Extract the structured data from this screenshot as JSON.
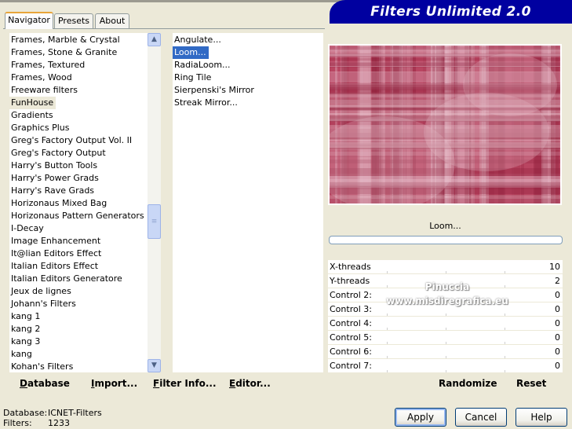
{
  "header": {
    "title": "Filters Unlimited 2.0"
  },
  "tabs": [
    {
      "label": "Navigator",
      "active": true
    },
    {
      "label": "Presets",
      "active": false
    },
    {
      "label": "About",
      "active": false
    }
  ],
  "categories": [
    "Frames, Marble & Crystal",
    "Frames, Stone & Granite",
    "Frames, Textured",
    "Frames, Wood",
    "Freeware filters",
    "FunHouse",
    "Gradients",
    "Graphics Plus",
    "Greg's Factory Output Vol. II",
    "Greg's Factory Output",
    "Harry's Button Tools",
    "Harry's Power Grads",
    "Harry's Rave Grads",
    "Horizonaus Mixed Bag",
    "Horizonaus Pattern Generators",
    "I-Decay",
    "Image Enhancement",
    "It@lian Editors Effect",
    "Italian Editors Effect",
    "Italian Editors Generatore",
    "Jeux de lignes",
    "Johann's Filters",
    "kang 1",
    "kang 2",
    "kang 3",
    "kang",
    "Kohan's Filters"
  ],
  "selected_category": "FunHouse",
  "filters": [
    "Angulate...",
    "Loom...",
    "RadiaLoom...",
    "Ring Tile",
    "Sierpenski's Mirror",
    "Streak Mirror..."
  ],
  "selected_filter": "Loom...",
  "toolbar": {
    "database": "Database",
    "import": "Import...",
    "filter_info": "Filter Info...",
    "editor": "Editor..."
  },
  "preview": {
    "filter_name": "Loom...",
    "base_color": "#B94561",
    "dark_color": "#8E1F3A",
    "light_color": "#E7BFCB"
  },
  "controls": [
    {
      "label": "X-threads",
      "value": "10"
    },
    {
      "label": "Y-threads",
      "value": "2"
    },
    {
      "label": "Control 2:",
      "value": "0"
    },
    {
      "label": "Control 3:",
      "value": "0"
    },
    {
      "label": "Control 4:",
      "value": "0"
    },
    {
      "label": "Control 5:",
      "value": "0"
    },
    {
      "label": "Control 6:",
      "value": "0"
    },
    {
      "label": "Control 7:",
      "value": "0"
    }
  ],
  "watermark": {
    "line1": "Pinuccia",
    "line2": "www.misdiregrafica.eu"
  },
  "right_actions": {
    "randomize": "Randomize",
    "reset": "Reset"
  },
  "status": {
    "database_label": "Database:",
    "database_value": "ICNET-Filters",
    "filters_label": "Filters:",
    "filters_value": "1233"
  },
  "buttons": {
    "apply": "Apply",
    "cancel": "Cancel",
    "help": "Help"
  }
}
